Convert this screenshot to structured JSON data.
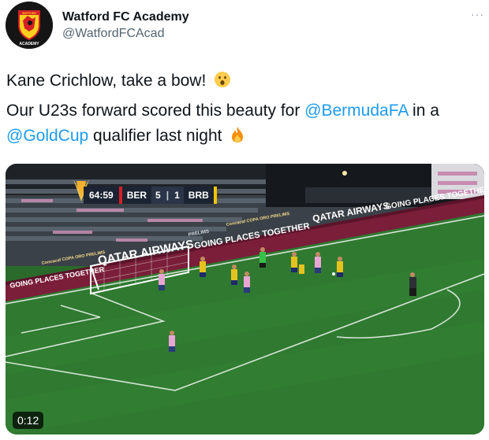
{
  "account": {
    "display_name": "Watford FC Academy",
    "handle": "@WatfordFCAcad",
    "avatar_top_text": "WATFORD",
    "avatar_bottom_text": "ACADEMY"
  },
  "menu": {
    "more_label": "···"
  },
  "tweet": {
    "line1": "Kane Crichlow, take a bow!",
    "line2_text": "Our U23s forward scored this beauty for ",
    "line2_mention": "@BermudaFA",
    "line2_suffix": " in a",
    "line3_mention": "@GoldCup",
    "line3_text": " qualifier last night"
  },
  "video": {
    "scorebug": {
      "clock": "64:59",
      "home_team": "BER",
      "home_score": "5",
      "away_score": "1",
      "away_team": "BRB"
    },
    "board_texts": {
      "qatar": "QATAR AIRWAYS",
      "going_places": "GOING PLACES TOGETHER",
      "concacaf": "Concacaf COPA ORO PRELIMS",
      "prelims": "PRELIMS"
    },
    "duration": "0:12"
  },
  "colors": {
    "mention": "#1d9bf0",
    "pitch": "#2f7a30",
    "board": "#7b1e3a"
  }
}
